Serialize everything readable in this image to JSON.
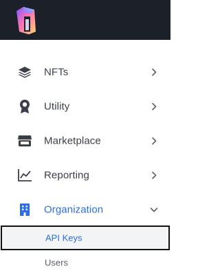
{
  "header": {
    "logo_icon": "brand-logo-icon"
  },
  "nav": {
    "items": [
      {
        "label": "NFTs",
        "icon": "layers-icon"
      },
      {
        "label": "Utility",
        "icon": "badge-icon"
      },
      {
        "label": "Marketplace",
        "icon": "store-icon"
      },
      {
        "label": "Reporting",
        "icon": "chart-line-icon"
      },
      {
        "label": "Organization",
        "icon": "building-icon"
      }
    ],
    "active_color": "#2c6ee6"
  },
  "subnav": {
    "items": [
      {
        "label": "API Keys"
      },
      {
        "label": "Users"
      }
    ]
  }
}
